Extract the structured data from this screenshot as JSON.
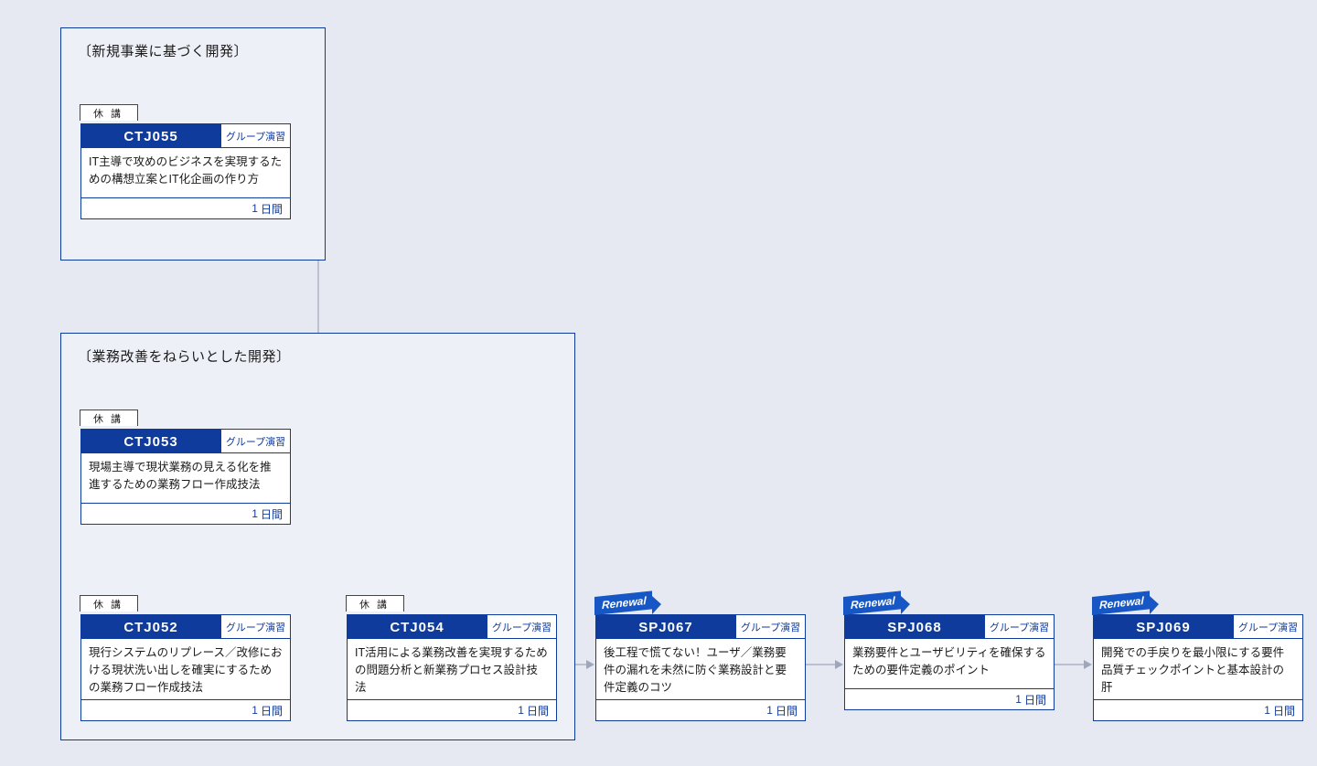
{
  "groups": {
    "top": {
      "title": "〔新規事業に基づく開発〕"
    },
    "bottom": {
      "title": "〔業務改善をねらいとした開発〕"
    }
  },
  "labels": {
    "suspended": "休講",
    "renewal": "Renewal",
    "group_exercise": "グループ演習",
    "duration_unit": "日間"
  },
  "cards": {
    "ctj055": {
      "code": "CTJ055",
      "desc": "IT主導で攻めのビジネスを実現するための構想立案とIT化企画の作り方",
      "dur": "1"
    },
    "ctj053": {
      "code": "CTJ053",
      "desc": "現場主導で現状業務の見える化を推進するための業務フロー作成技法",
      "dur": "1"
    },
    "ctj052": {
      "code": "CTJ052",
      "desc": "現行システムのリプレース／改修における現状洗い出しを確実にするための業務フロー作成技法",
      "dur": "1"
    },
    "ctj054": {
      "code": "CTJ054",
      "desc": "IT活用による業務改善を実現するための問題分析と新業務プロセス設計技法",
      "dur": "1"
    },
    "spj067": {
      "code": "SPJ067",
      "desc": "後工程で慌てない！ユーザ／業務要件の漏れを未然に防ぐ業務設計と要件定義のコツ",
      "dur": "1"
    },
    "spj068": {
      "code": "SPJ068",
      "desc": "業務要件とユーザビリティを確保するための要件定義のポイント",
      "dur": "1"
    },
    "spj069": {
      "code": "SPJ069",
      "desc": "開発での手戻りを最小限にする要件品質チェックポイントと基本設計の肝",
      "dur": "1"
    }
  }
}
